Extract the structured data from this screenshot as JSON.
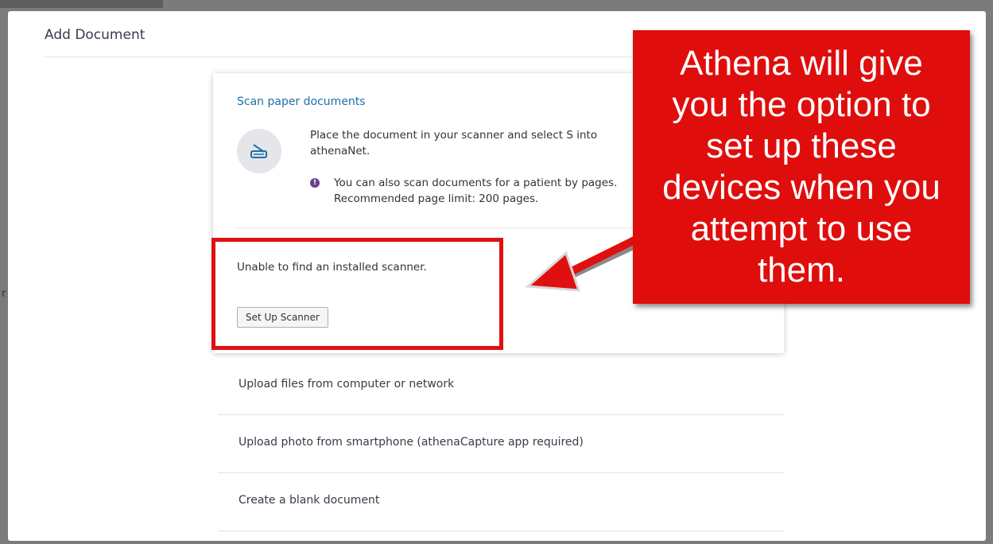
{
  "background": {
    "partial_text": "r"
  },
  "modal": {
    "title": "Add Document"
  },
  "scan_section": {
    "heading": "Scan paper documents",
    "icon": "scanner-icon",
    "description": "Place the document in your scanner and select S into athenaNet.",
    "note_icon": "info-icon",
    "note": "You can also scan documents for a patient by pages. Recommended page limit: 200 pages.",
    "status": "Unable to find an installed scanner.",
    "setup_button": "Set Up Scanner"
  },
  "options": [
    {
      "label": "Upload files from computer or network"
    },
    {
      "label": "Upload photo from smartphone (athenaCapture app required)"
    },
    {
      "label": "Create a blank document"
    }
  ],
  "annotation": {
    "callout_text": "Athena will give you the option to set up these devices when you attempt to use them.",
    "color": "#e00d0d"
  }
}
